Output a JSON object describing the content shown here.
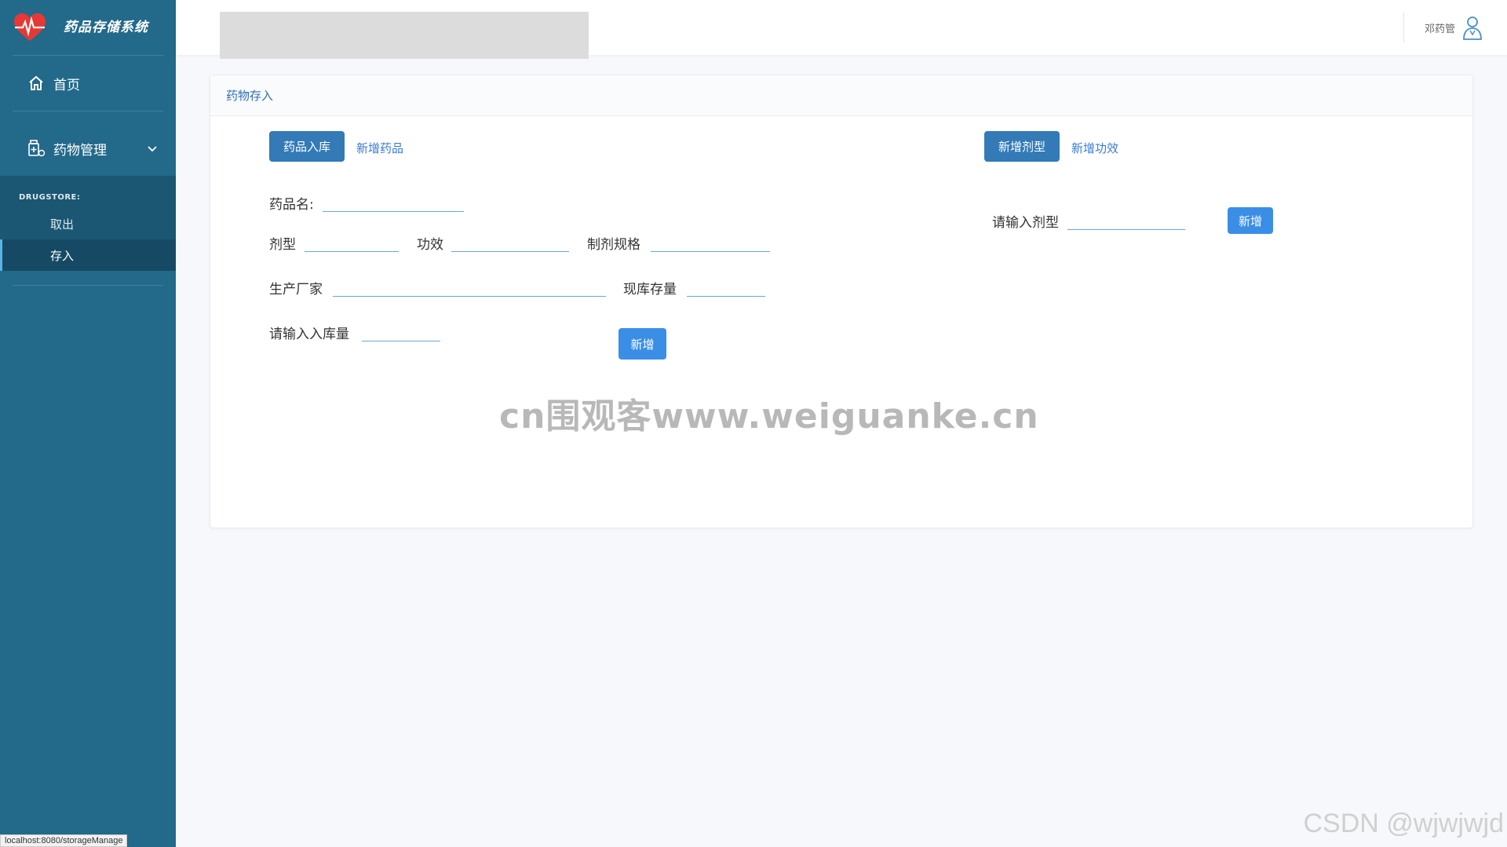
{
  "brand": {
    "title": "药品存储系统"
  },
  "sidebar": {
    "home_label": "首页",
    "drug_mgmt_label": "药物管理",
    "submenu_heading": "DRUGSTORE:",
    "sub_items": [
      {
        "label": "取出"
      },
      {
        "label": "存入"
      }
    ]
  },
  "header": {
    "user_name": "邓药管"
  },
  "card": {
    "title": "药物存入",
    "left_tabs": {
      "active_button": "药品入库",
      "link": "新增药品"
    },
    "right_tabs": {
      "active_button": "新增剂型",
      "link": "新增功效"
    },
    "form": {
      "drug_name_label": "药品名:",
      "dosage_form_label": "剂型",
      "efficacy_label": "功效",
      "spec_label": "制剂规格",
      "manufacturer_label": "生产厂家",
      "stock_label": "现库存量",
      "quantity_label": "请输入入库量",
      "submit_label": "新增"
    },
    "right_form": {
      "dosage_input_label": "请输入剂型",
      "submit_label": "新增"
    }
  },
  "watermark": "cn围观客www.weiguanke.cn",
  "csdn_watermark": "CSDN @wjwjwjd",
  "status_url": "localhost:8080/storageManage"
}
